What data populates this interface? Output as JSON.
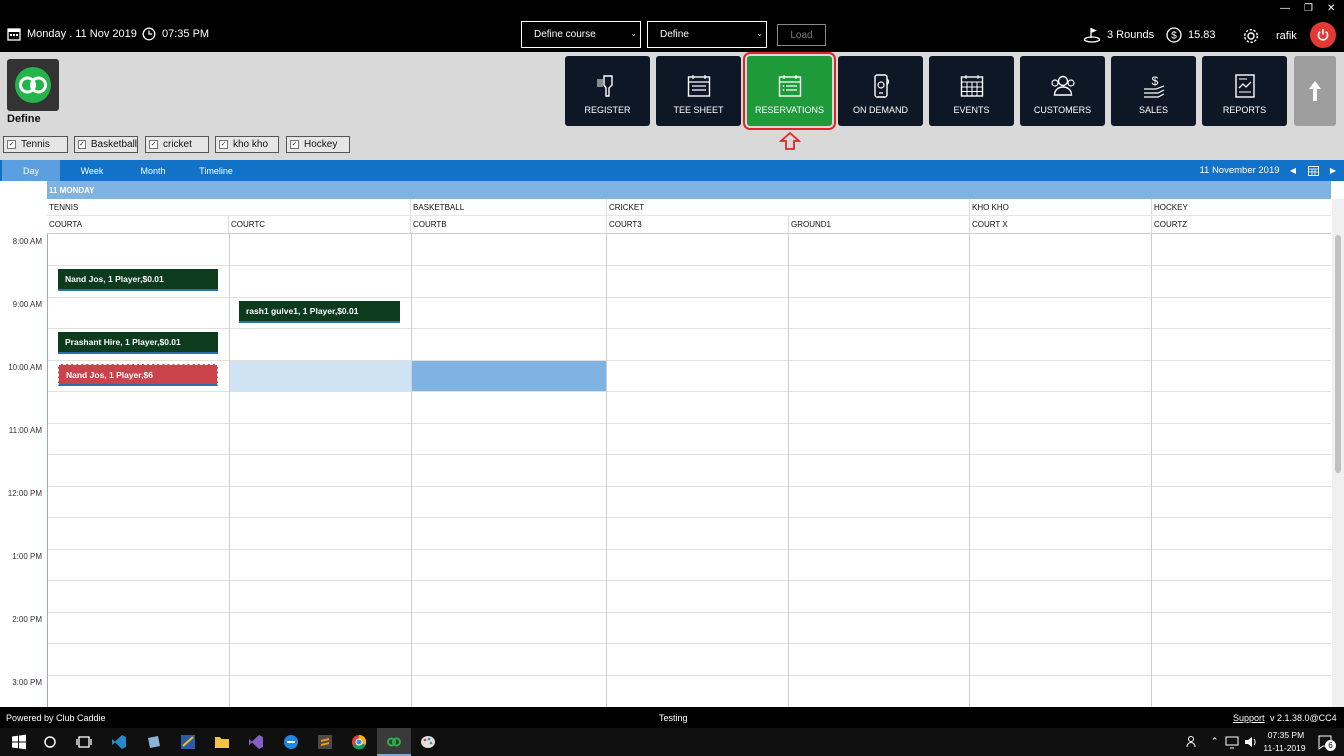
{
  "topbar": {
    "date": "Monday .  11 Nov 2019",
    "time": "07:35 PM",
    "course_select": "Define  course",
    "define_select": "Define",
    "load_label": "Load",
    "rounds": "3 Rounds",
    "balance": "15.83",
    "user": "rafik"
  },
  "header": {
    "org_name": "Define",
    "nav": [
      {
        "label": "REGISTER",
        "icon": "barcode-scanner-icon"
      },
      {
        "label": "TEE SHEET",
        "icon": "calendar-icon"
      },
      {
        "label": "RESERVATIONS",
        "icon": "calendar-list-icon"
      },
      {
        "label": "ON DEMAND",
        "icon": "mobile-phone-icon"
      },
      {
        "label": "EVENTS",
        "icon": "event-calendar-icon"
      },
      {
        "label": "CUSTOMERS",
        "icon": "users-icon"
      },
      {
        "label": "SALES",
        "icon": "money-icon"
      },
      {
        "label": "REPORTS",
        "icon": "report-icon"
      }
    ],
    "filters": [
      "Tennis",
      "Basketball",
      "cricket",
      "kho kho",
      "Hockey"
    ]
  },
  "view_tabs": [
    "Day",
    "Week",
    "Month",
    "Timeline"
  ],
  "date_display": "11 November 2019",
  "calendar": {
    "day_header": "11 MONDAY",
    "groups": [
      "TENNIS",
      "BASKETBALL",
      "CRICKET",
      "KHO KHO",
      "HOCKEY"
    ],
    "courts": [
      "COURTA",
      "COURTC",
      "COURTB",
      "COURT3",
      "GROUND1",
      "COURT X",
      "COURTZ"
    ],
    "times": [
      "8:00 AM",
      "9:00 AM",
      "10:00 AM",
      "11:00 AM",
      "12:00 PM",
      "1:00 PM",
      "2:00 PM",
      "3:00 PM"
    ],
    "appointments": [
      {
        "text": "Nand Jos, 1 Player,$0.01"
      },
      {
        "text": "rash1 gulve1, 1 Player,$0.01"
      },
      {
        "text": "Prashant Hire, 1 Player,$0.01"
      },
      {
        "text": "Nand Jos, 1 Player,$6"
      }
    ]
  },
  "status": {
    "powered_by": "Powered by Club Caddie",
    "center": "Testing",
    "support": "Support",
    "version": "v 2.1.38.0@CC4"
  },
  "taskbar": {
    "time": "07:35 PM",
    "date": "11-11-2019",
    "notifications": "6"
  },
  "colors": {
    "accent_blue": "#1272c7",
    "active_green": "#1e9a3b",
    "appt_green": "#0d3b1e",
    "appt_red": "#c9434b",
    "highlight_red": "#e0252a"
  }
}
